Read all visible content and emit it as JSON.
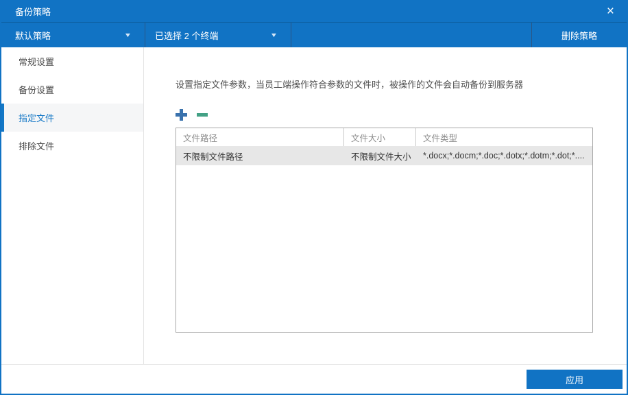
{
  "window": {
    "title": "备份策略"
  },
  "icons": {
    "close": "×",
    "chevron_down": "▼",
    "add": "plus-icon",
    "remove": "minus-icon"
  },
  "toolbar": {
    "policy_dropdown": "默认策略",
    "terminal_dropdown": "已选择 2 个终端",
    "delete_button": "删除策略"
  },
  "sidebar": {
    "items": [
      {
        "label": "常规设置",
        "active": false
      },
      {
        "label": "备份设置",
        "active": false
      },
      {
        "label": "指定文件",
        "active": true
      },
      {
        "label": "排除文件",
        "active": false
      }
    ]
  },
  "main": {
    "description": "设置指定文件参数，当员工端操作符合参数的文件时，被操作的文件会自动备份到服务器",
    "table": {
      "headers": [
        "文件路径",
        "文件大小",
        "文件类型"
      ],
      "rows": [
        [
          "不限制文件路径",
          "不限制文件大小",
          "*.docx;*.docm;*.doc;*.dotx;*.dotm;*.dot;*...."
        ]
      ]
    }
  },
  "footer": {
    "apply_button": "应用"
  },
  "colors": {
    "accent": "#1173c4",
    "plus": "#3a72ad",
    "minus": "#43a185",
    "row_bg": "#e7e7e7"
  }
}
